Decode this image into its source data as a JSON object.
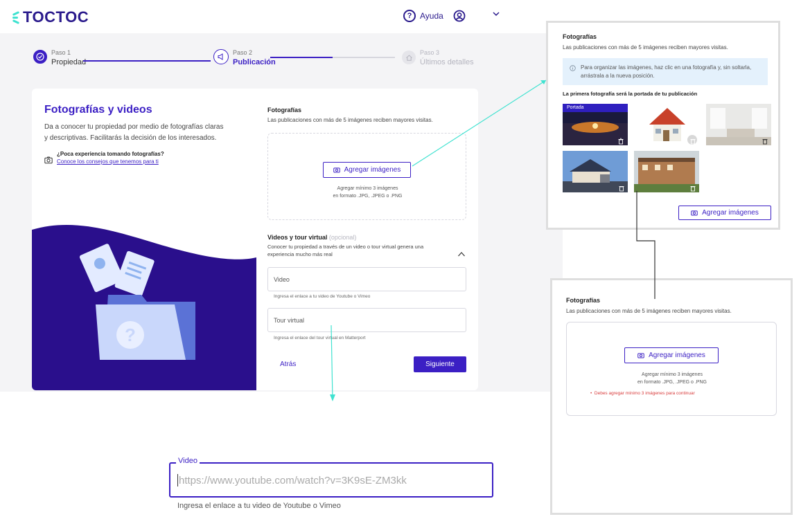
{
  "header": {
    "logo_text": "TOCTOC",
    "help_label": "Ayuda",
    "help_icon": "question-circle-icon",
    "user_icon": "user-circle-icon",
    "menu_icon": "chevron-down-icon"
  },
  "stepper": [
    {
      "small": "Paso 1",
      "label": "Propiedad",
      "state": "done"
    },
    {
      "small": "Paso 2",
      "label": "Publicación",
      "state": "active"
    },
    {
      "small": "Paso 3",
      "label": "Últimos detalles",
      "state": "pending"
    }
  ],
  "intro": {
    "title": "Fotografías y videos",
    "description": "Da a conocer tu propiedad por medio de fotografías claras y descriptivas. Facilitarás la decisión de los interesados.",
    "tip_title": "¿Poca experiencia tomando fotografías?",
    "tip_link": "Conoce los consejos que tenemos para ti"
  },
  "photos": {
    "title": "Fotografías",
    "subtitle": "Las publicaciones con más de 5 imágenes reciben mayores visitas.",
    "add_button": "Agregar imágenes",
    "hint_line1": "Agregar mínimo 3 imágenes",
    "hint_line2": "en formato .JPG, .JPEG o .PNG"
  },
  "videos": {
    "title": "Videos y tour virtual",
    "optional": "(opcional)",
    "description": "Conocer tu propiedad a través de un video o tour virtual genera una experiencia mucho más real",
    "video_placeholder": "Video",
    "video_hint": "Ingresa el enlace a tu video de Youtube o Vimeo",
    "tour_placeholder": "Tour virtual",
    "tour_hint": "Ingresa el enlace del tour virtual en Matterport"
  },
  "actions": {
    "back": "Atrás",
    "next": "Siguiente"
  },
  "callout_gallery": {
    "title": "Fotografías",
    "subtitle": "Las publicaciones con más de 5 imágenes reciben mayores visitas.",
    "info": "Para organizar las imágenes, haz clic en una fotografía y, sin soltarla, arrástrala a la nueva posición.",
    "cover_note": "La primera fotografía será la portada de tu publicación",
    "cover_badge": "Portada",
    "add_button": "Agregar imágenes"
  },
  "callout_error": {
    "title": "Fotografías",
    "subtitle": "Las publicaciones con más de 5 imágenes reciben mayores visitas.",
    "add_button": "Agregar imágenes",
    "hint_line1": "Agregar mínimo 3 imágenes",
    "hint_line2": "en formato .JPG, .JPEG o .PNG",
    "error": "Debes agregar mínimo 3 imágenes para continuar"
  },
  "callout_video": {
    "legend": "Video",
    "value": "https://www.youtube.com/watch?v=3K9sE-ZM3kk",
    "hint": "Ingresa el enlace a tu video de Youtube o Vimeo"
  },
  "colors": {
    "brand": "#3b1fc4",
    "dark_brand": "#2a0f8c",
    "arrow": "#3fe2d0",
    "error": "#d83b3b"
  }
}
